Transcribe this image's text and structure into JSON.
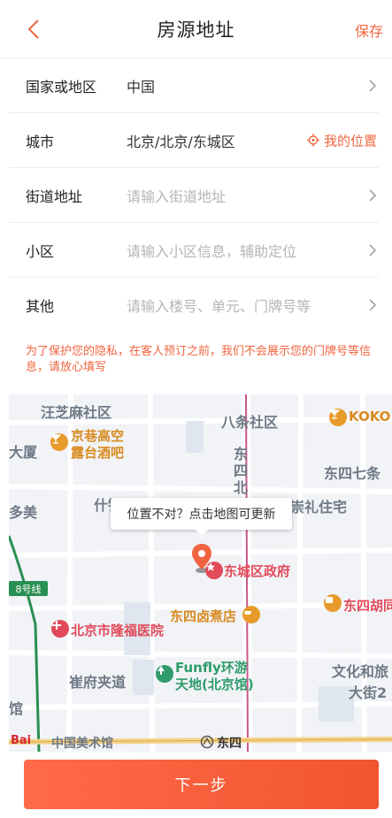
{
  "header": {
    "title": "房源地址",
    "save_label": "保存"
  },
  "form": {
    "country": {
      "label": "国家或地区",
      "value": "中国"
    },
    "city": {
      "label": "城市",
      "value": "北京/北京/东城区",
      "locate_label": "我的位置"
    },
    "street": {
      "label": "街道地址",
      "placeholder": "请输入街道地址"
    },
    "community": {
      "label": "小区",
      "placeholder": "请输入小区信息，辅助定位"
    },
    "other": {
      "label": "其他",
      "placeholder": "请输入楼号、单元、门牌号等"
    }
  },
  "notice": "为了保护您的隐私，在客人预订之前，我们不会展示您的门牌号等信息，请放心填写",
  "map": {
    "tooltip": "位置不对？点击地图可更新",
    "labels": {
      "wangzhima": "汪芝麻社区",
      "batiao": "八条社区",
      "dasha": "大厦",
      "dongsi_qitiao": "东四七条",
      "chongli": "崇礼住宅",
      "duomei": "多美",
      "shijin": "什锦花园",
      "cuifu": "崔府夹道",
      "wenhua": "文化和旅",
      "dajie": "大街2",
      "guan": "馆",
      "dongsi_v": [
        "东",
        "四",
        "北"
      ]
    },
    "pois": {
      "koko": "KOKO",
      "jingxiang": "京巷高空",
      "lutai": "露台酒吧",
      "gov": "东城区政府",
      "lufu": "东四卤煮店",
      "hospital": "北京市隆福医院",
      "funfly1": "Funfly环游",
      "funfly2": "天地(北京馆)",
      "meishu": "中国美术馆",
      "dongsi_station": "东四",
      "dongsi_hutong": "东四胡同"
    },
    "line_badge": "8号线",
    "baidu": "Bai"
  },
  "next_label": "下一步"
}
